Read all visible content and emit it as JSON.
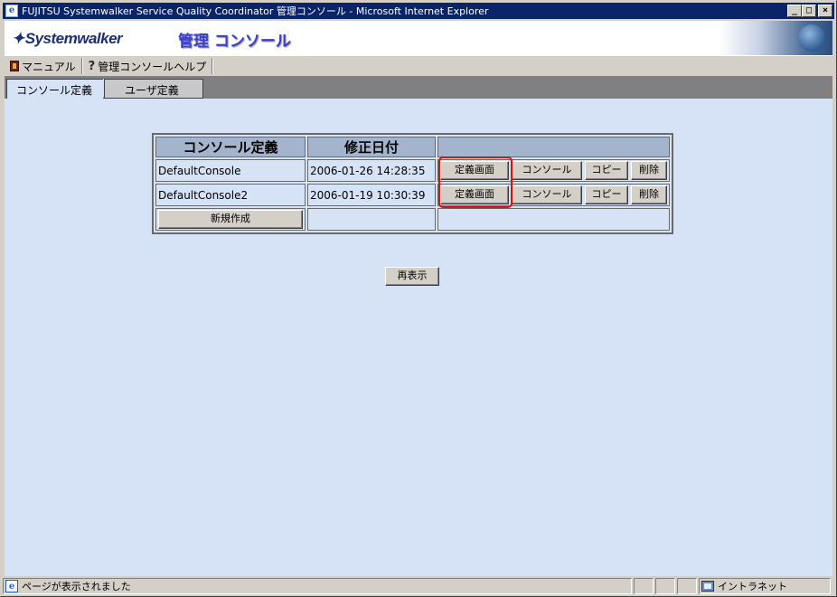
{
  "window": {
    "title": "FUJITSU Systemwalker Service Quality Coordinator 管理コンソール - Microsoft Internet Explorer",
    "min": "_",
    "max": "□",
    "close": "×"
  },
  "banner": {
    "logo": "Systemwalker",
    "title": "管理 コンソール"
  },
  "toolbar": {
    "manual": "マニュアル",
    "help": "管理コンソールヘルプ"
  },
  "tabs": [
    {
      "label": "コンソール定義",
      "active": true
    },
    {
      "label": "ユーザ定義",
      "active": false
    }
  ],
  "table": {
    "headers": [
      "コンソール定義",
      "修正日付",
      ""
    ],
    "rows": [
      {
        "name": "DefaultConsole",
        "date": "2006-01-26 14:28:35"
      },
      {
        "name": "DefaultConsole2",
        "date": "2006-01-19 10:30:39"
      }
    ],
    "buttons": {
      "define": "定義画面",
      "console": "コンソール",
      "copy": "コピー",
      "delete": "削除"
    },
    "new_button": "新規作成"
  },
  "refresh_button": "再表示",
  "status": {
    "message": "ページが表示されました",
    "zone": "イントラネット"
  },
  "colors": {
    "content_bg": "#d6e2f5",
    "header_bg": "#a4b4cc",
    "titlebar": "#0a246a",
    "highlight": "#e01010"
  }
}
